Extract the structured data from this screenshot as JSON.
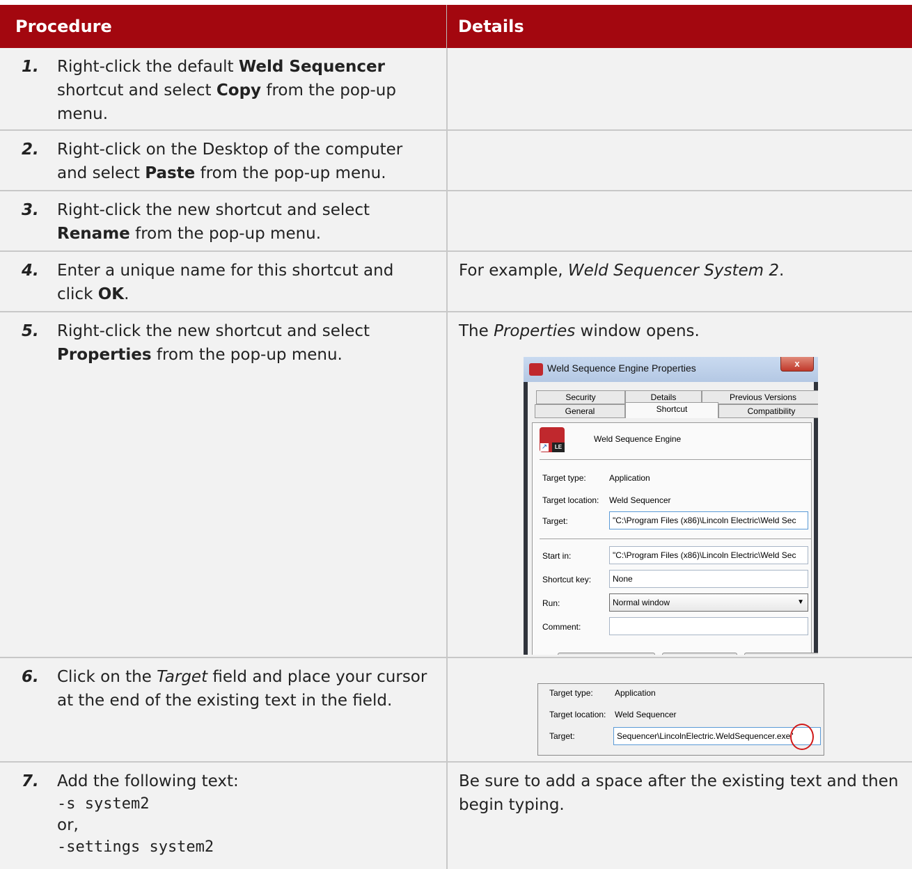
{
  "header": {
    "procedure": "Procedure",
    "details": "Details"
  },
  "steps": [
    {
      "num": "1.",
      "pre1": "Right-click the default ",
      "b1": "Weld Sequencer",
      "post1": " shortcut and select ",
      "b2": "Copy",
      "post2": " from the pop-up menu."
    },
    {
      "num": "2.",
      "pre1": "Right-click on the Desktop of the computer and select ",
      "b1": "Paste",
      "post1": " from the pop-up menu."
    },
    {
      "num": "3.",
      "pre1": "Right-click the new shortcut and select ",
      "b1": "Rename",
      "post1": " from the pop-up menu."
    },
    {
      "num": "4.",
      "pre1": "Enter a unique name for this shortcut and click ",
      "b1": "OK",
      "post1": ".",
      "detail_pre": "For example, ",
      "detail_em": "Weld Sequencer System 2",
      "detail_post": "."
    },
    {
      "num": "5.",
      "pre1": "Right-click the new shortcut and select ",
      "b1": "Properties",
      "post1": " from the pop-up menu.",
      "detail_pre": "The ",
      "detail_em": "Properties",
      "detail_post": " window opens."
    },
    {
      "num": "6.",
      "pre1": "Click on the ",
      "em1": "Target",
      "post1": " field and place your cursor at the end of the existing text in the field."
    },
    {
      "num": "7.",
      "pre1": "Add the following text:",
      "code1": "-s system2",
      "or": "or,",
      "code2": "-settings system2",
      "detail": "Be sure to add a space after the existing text and then begin typing."
    }
  ],
  "window": {
    "title": "Weld Sequence Engine Properties",
    "close": "x",
    "tabs_row1": [
      "Security",
      "Details",
      "Previous Versions"
    ],
    "tabs_row2": [
      "General",
      "Shortcut",
      "Compatibility"
    ],
    "app_name": "Weld Sequence Engine",
    "icon_badge": "LE",
    "target_type_label": "Target type:",
    "target_type": "Application",
    "target_location_label": "Target location:",
    "target_location": "Weld Sequencer",
    "target_label": "Target:",
    "target": "\"C:\\Program Files (x86)\\Lincoln Electric\\Weld Sec",
    "start_in_label": "Start in:",
    "start_in": "\"C:\\Program Files (x86)\\Lincoln Electric\\Weld Sec",
    "shortcut_key_label": "Shortcut key:",
    "shortcut_key": "None",
    "run_label": "Run:",
    "run": "Normal window",
    "comment_label": "Comment:"
  },
  "crop": {
    "target_type_label": "Target type:",
    "target_type": "Application",
    "target_location_label": "Target location:",
    "target_location": "Weld Sequencer",
    "target_label": "Target:",
    "target": "Sequencer\\LincolnElectric.WeldSequencer.exe\""
  }
}
